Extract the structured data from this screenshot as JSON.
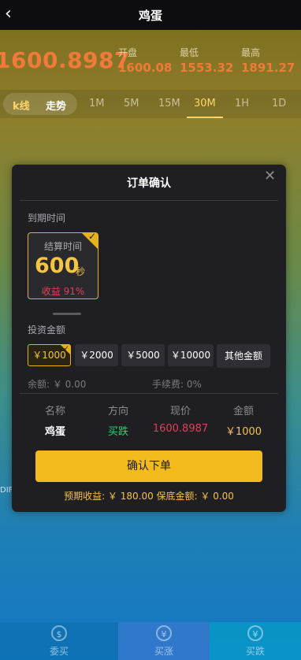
{
  "header": {
    "title": "鸡蛋"
  },
  "price": {
    "current": "1600.8987",
    "open_label": "开盘",
    "open": "1600.08",
    "low_label": "最低",
    "low": "1553.32",
    "high_label": "最高",
    "high": "1891.27"
  },
  "tabs": {
    "kline": "k线",
    "trend": "走势",
    "periods": [
      "1M",
      "5M",
      "15M",
      "30M",
      "1H",
      "1D"
    ],
    "active_period": "30M"
  },
  "modal": {
    "title": "订单确认",
    "expiry_label": "到期时间",
    "settle": {
      "label": "结算时间",
      "value": "600",
      "unit": "秒",
      "rate": "收益 91%"
    },
    "invest_label": "投资金额",
    "amounts": [
      "￥1000",
      "￥2000",
      "￥5000",
      "￥10000"
    ],
    "selected_amount": "￥1000",
    "other_amount": "其他金额",
    "balance": "余额: ￥ 0.00",
    "fee": "手续费: 0%",
    "table": {
      "headers": [
        "名称",
        "方向",
        "现价",
        "金额"
      ],
      "row": {
        "name": "鸡蛋",
        "direction": "买跌",
        "price": "1600.8987",
        "amount": "￥1000"
      }
    },
    "confirm": "确认下单",
    "footer": "预期收益: ￥ 180.00    保底金额: ￥ 0.00"
  },
  "bottom": {
    "tabs": [
      "委买",
      "买涨",
      "买跌"
    ]
  },
  "leftcut": "DIF",
  "colors": {
    "accent": "#f2ba1d",
    "down": "#e0405a",
    "up": "#2bd36c"
  }
}
